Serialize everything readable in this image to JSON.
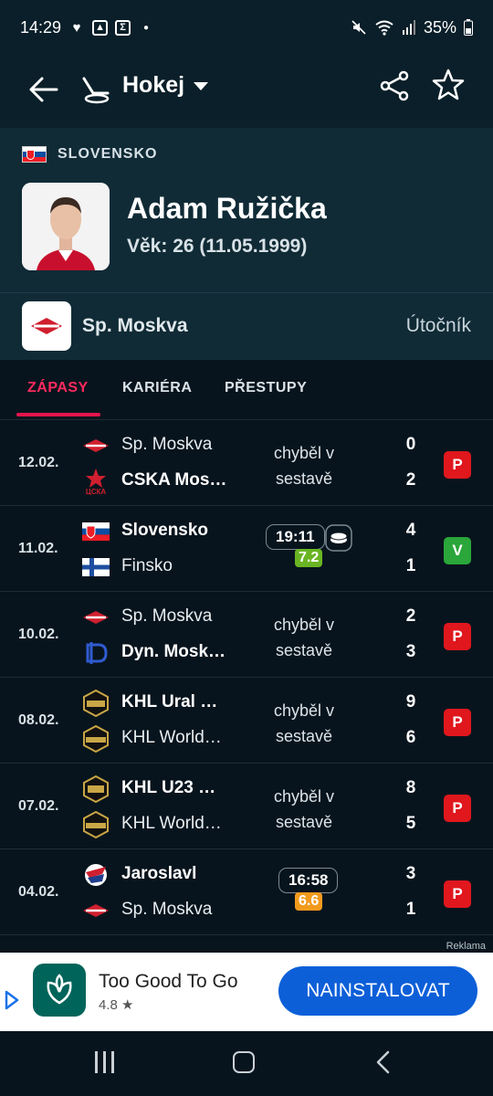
{
  "status_bar": {
    "time": "14:29",
    "battery": "35%"
  },
  "app_bar": {
    "sport": "Hokej"
  },
  "player": {
    "country": "SLOVENSKO",
    "name": "Adam Ružička",
    "age": "Věk: 26 (11.05.1999)",
    "team": "Sp. Moskva",
    "position": "Útočník"
  },
  "tabs": [
    "ZÁPASY",
    "KARIÉRA",
    "PŘESTUPY"
  ],
  "matches": [
    {
      "date": "12.02.",
      "home": "Sp. Moskva",
      "home_bold": false,
      "away": "CSKA Mos…",
      "away_bold": true,
      "home_score": "0",
      "away_score": "2",
      "status": "chyběl v sestavě",
      "result": "P",
      "home_logo": "spartak-logo",
      "away_logo": "cska-logo"
    },
    {
      "date": "11.02.",
      "home": "Slovensko",
      "home_bold": true,
      "away": "Finsko",
      "away_bold": false,
      "home_score": "4",
      "away_score": "1",
      "time_played": "19:11",
      "rating": "7.2",
      "rating_color": "#6ab523",
      "puck": true,
      "result": "V",
      "home_logo": "slovakia-flag",
      "away_logo": "finland-flag"
    },
    {
      "date": "10.02.",
      "home": "Sp. Moskva",
      "home_bold": false,
      "away": "Dyn. Mosk…",
      "away_bold": true,
      "home_score": "2",
      "away_score": "3",
      "status": "chyběl v sestavě",
      "result": "P",
      "home_logo": "spartak-logo",
      "away_logo": "dynamo-logo"
    },
    {
      "date": "08.02.",
      "home": "KHL Ural …",
      "home_bold": true,
      "away": "KHL World…",
      "away_bold": false,
      "home_score": "9",
      "away_score": "6",
      "status": "chyběl v sestavě",
      "result": "P",
      "home_logo": "khl-ural-logo",
      "away_logo": "khl-world-logo"
    },
    {
      "date": "07.02.",
      "home": "KHL U23 …",
      "home_bold": true,
      "away": "KHL World…",
      "away_bold": false,
      "home_score": "8",
      "away_score": "5",
      "status": "chyběl v sestavě",
      "result": "P",
      "home_logo": "khl-u23-logo",
      "away_logo": "khl-world-logo"
    },
    {
      "date": "04.02.",
      "home": "Jaroslavl",
      "home_bold": true,
      "away": "Sp. Moskva",
      "away_bold": false,
      "home_score": "3",
      "away_score": "1",
      "time_played": "16:58",
      "rating": "6.6",
      "rating_color": "#f29a1d",
      "puck": false,
      "result": "P",
      "home_logo": "lokomotiv-logo",
      "away_logo": "spartak-logo"
    }
  ],
  "ad": {
    "label": "Reklama",
    "app_name": "Too Good To Go",
    "rating": "4.8 ★",
    "button": "NAINSTALOVAT"
  },
  "colors": {
    "accent": "#e3154c",
    "lose": "#e0171d",
    "win": "#2aa63a",
    "ad_button": "#0d5fd8"
  }
}
